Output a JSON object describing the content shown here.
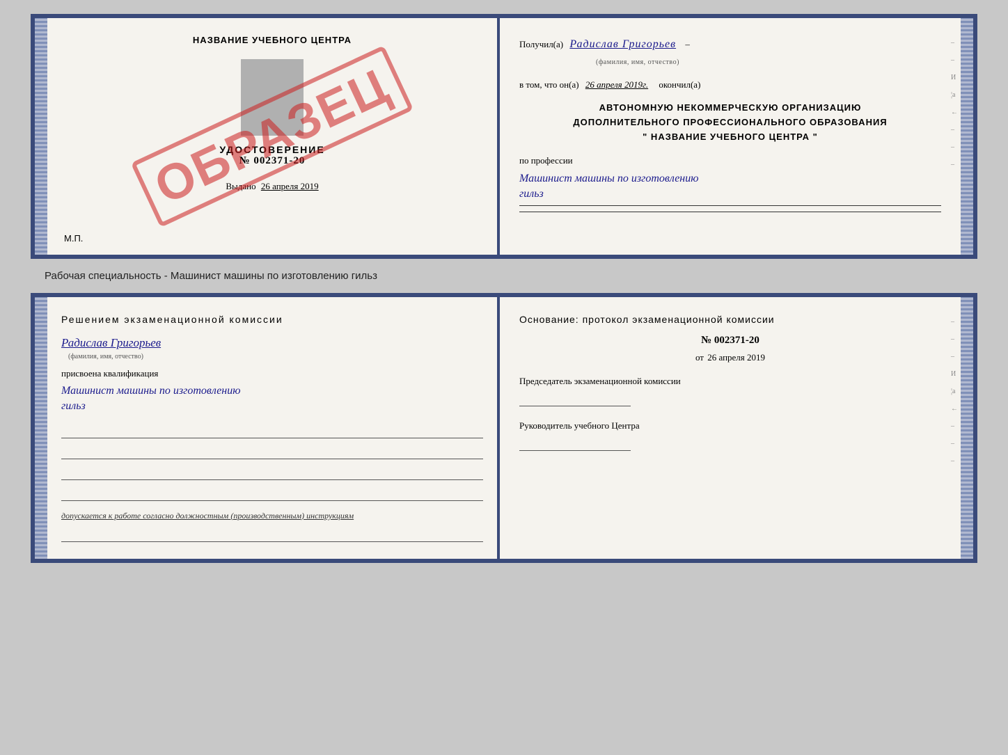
{
  "topDoc": {
    "left": {
      "title": "НАЗВАНИЕ УЧЕБНОГО ЦЕНТРА",
      "stamp": "ОБРАЗЕЦ",
      "certLabel": "УДОСТОВЕРЕНИЕ",
      "certNumber": "№ 002371-20",
      "issuedText": "Выдано",
      "issuedDate": "26 апреля 2019",
      "mpLabel": "М.П."
    },
    "right": {
      "receivedLabel": "Получил(а)",
      "receivedName": "Радислав Григорьев",
      "fioCaption": "(фамилия, имя, отчество)",
      "dash1": "–",
      "inThatText": "в том, что он(а)",
      "completedDate": "26 апреля 2019г.",
      "completedLabel": "окончил(а)",
      "orgLine1": "АВТОНОМНУЮ НЕКОММЕРЧЕСКУЮ ОРГАНИЗАЦИЮ",
      "orgLine2": "ДОПОЛНИТЕЛЬНОГО ПРОФЕССИОНАЛЬНОГО ОБРАЗОВАНИЯ",
      "orgLine3": "\" НАЗВАНИЕ УЧЕБНОГО ЦЕНТРА \"",
      "professionLabel": "по профессии",
      "professionName": "Машинист машины по изготовлению",
      "professionName2": "гильз"
    }
  },
  "caption": "Рабочая специальность - Машинист машины по изготовлению гильз",
  "bottomDoc": {
    "left": {
      "commissionTitle": "Решением экзаменационной комиссии",
      "personName": "Радислав Григорьев",
      "fioCaption": "(фамилия, имя, отчество)",
      "assignedLabel": "присвоена квалификация",
      "qualificationName": "Машинист машины по изготовлению",
      "qualificationName2": "гильз",
      "допускText": "допускается к работе согласно должностным (производственным) инструкциям"
    },
    "right": {
      "osnovaTitle": "Основание: протокол экзаменационной комиссии",
      "protocolNumber": "№ 002371-20",
      "protocolDatePrefix": "от",
      "protocolDate": "26 апреля 2019",
      "chairLabel": "Председатель экзаменационной комиссии",
      "headLabel": "Руководитель учебного Центра"
    }
  }
}
